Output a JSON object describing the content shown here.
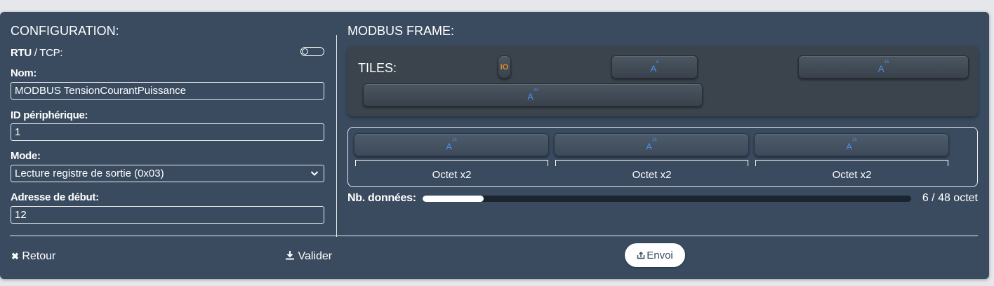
{
  "config": {
    "title": "CONFIGURATION:",
    "protocol": {
      "rtu": "RTU",
      "sep": " / ",
      "tcp": "TCP:"
    },
    "protocol_toggle": "off",
    "name_label": "Nom:",
    "name_value": "MODBUS TensionCourantPuissance",
    "device_id_label": "ID périphérique:",
    "device_id_value": "1",
    "mode_label": "Mode:",
    "mode_value": "Lecture registre de sortie (0x03)",
    "start_address_label": "Adresse de début:",
    "start_address_value": "12"
  },
  "frame": {
    "title": "MODBUS FRAME:",
    "tiles_label": "TILES:",
    "tiles": [
      {
        "kind": "io",
        "text": "IO",
        "icon": "io-icon"
      },
      {
        "kind": "analog",
        "icon": "a-icon",
        "base": "A",
        "sup": "8"
      },
      {
        "kind": "analog",
        "icon": "a-icon",
        "base": "A",
        "sup": "16"
      },
      {
        "kind": "analog",
        "icon": "a-icon",
        "base": "A",
        "sup": "32"
      }
    ],
    "frame_tiles": [
      {
        "icon": "a-icon",
        "base": "A",
        "sup": "16",
        "caption": "Octet x2"
      },
      {
        "icon": "a-icon",
        "base": "A",
        "sup": "16",
        "caption": "Octet x2"
      },
      {
        "icon": "a-icon",
        "base": "A",
        "sup": "16",
        "caption": "Octet x2"
      }
    ],
    "data_count_label": "Nb. données:",
    "data_count": {
      "current": 6,
      "max": 48,
      "text": "6 / 48 octet"
    }
  },
  "footer": {
    "back_label": "Retour",
    "back_icon": "close-icon",
    "validate_label": "Valider",
    "validate_icon": "download-icon",
    "send_label": "Envoi",
    "send_icon": "upload-icon"
  },
  "colors": {
    "panel_bg": "#3a4b60",
    "accent_blue": "#4a90e2",
    "io_orange": "#e88a2a"
  }
}
